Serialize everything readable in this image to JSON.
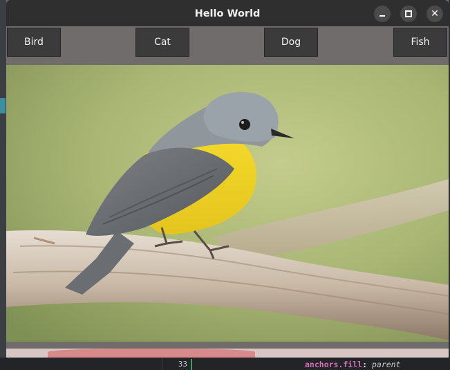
{
  "window": {
    "title": "Hello World",
    "controls": [
      "minimize-icon",
      "maximize-icon",
      "close-icon"
    ]
  },
  "toolbar": {
    "buttons": [
      {
        "label": "Bird"
      },
      {
        "label": "Cat"
      },
      {
        "label": "Dog"
      },
      {
        "label": "Fish"
      }
    ]
  },
  "editor": {
    "line_number": "33",
    "code_key": "anchors.fill",
    "code_colon": ":",
    "code_value": "parent"
  },
  "colors": {
    "toolbar_bg": "#6f6c6b",
    "button_bg": "#3b3b3b",
    "titlebar_bg": "#2f2f2f"
  }
}
